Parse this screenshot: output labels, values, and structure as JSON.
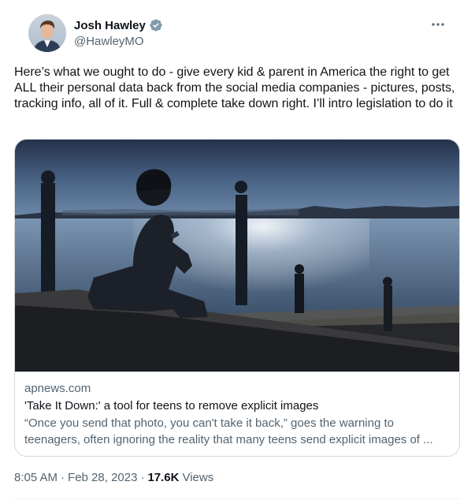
{
  "author": {
    "display_name": "Josh Hawley",
    "handle": "@HawleyMO",
    "verified_icon": "verified-badge-icon",
    "verified_color": "#829aab"
  },
  "more_icon": "more-horizontal-icon",
  "tweet": {
    "text": "Here’s what we ought to do - give every kid & parent in America the right to get ALL their personal data back from the social media companies - pictures, posts, tracking info, all of it. Full & complete take down right. I’ll intro legislation to do it"
  },
  "card": {
    "domain": "apnews.com",
    "title": "'Take It Down:' a tool for teens to remove explicit images",
    "description": "“Once you send that photo, you can't take it back,” goes the warning to teenagers, often ignoring the reality that many teens send explicit images of ...",
    "image_subject": "silhouette of teen on phone by waterfront"
  },
  "meta": {
    "time": "8:05 AM",
    "date": "Feb 28, 2023",
    "separator": "·",
    "views_count": "17.6K",
    "views_label": "Views"
  },
  "colors": {
    "text_primary": "#0f1419",
    "text_secondary": "#536471",
    "border": "#cfd9de"
  }
}
